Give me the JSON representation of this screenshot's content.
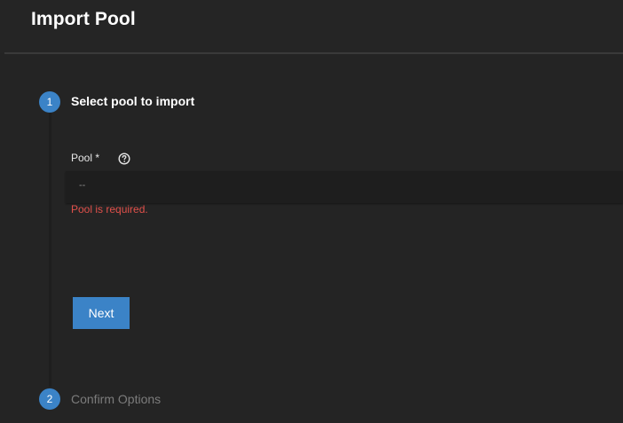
{
  "header": {
    "title": "Import Pool"
  },
  "steps": [
    {
      "number": "1",
      "label": "Select pool to import",
      "state": "active"
    },
    {
      "number": "2",
      "label": "Confirm Options",
      "state": "inactive"
    }
  ],
  "form": {
    "pool_label": "Pool *",
    "help_icon": "question-circle-icon",
    "pool_value": "--",
    "error": "Pool is required.",
    "next_label": "Next"
  },
  "colors": {
    "background": "#242424",
    "accent": "#3b83c7",
    "error": "#e0504a",
    "inactive_text": "#7c7c7c"
  }
}
